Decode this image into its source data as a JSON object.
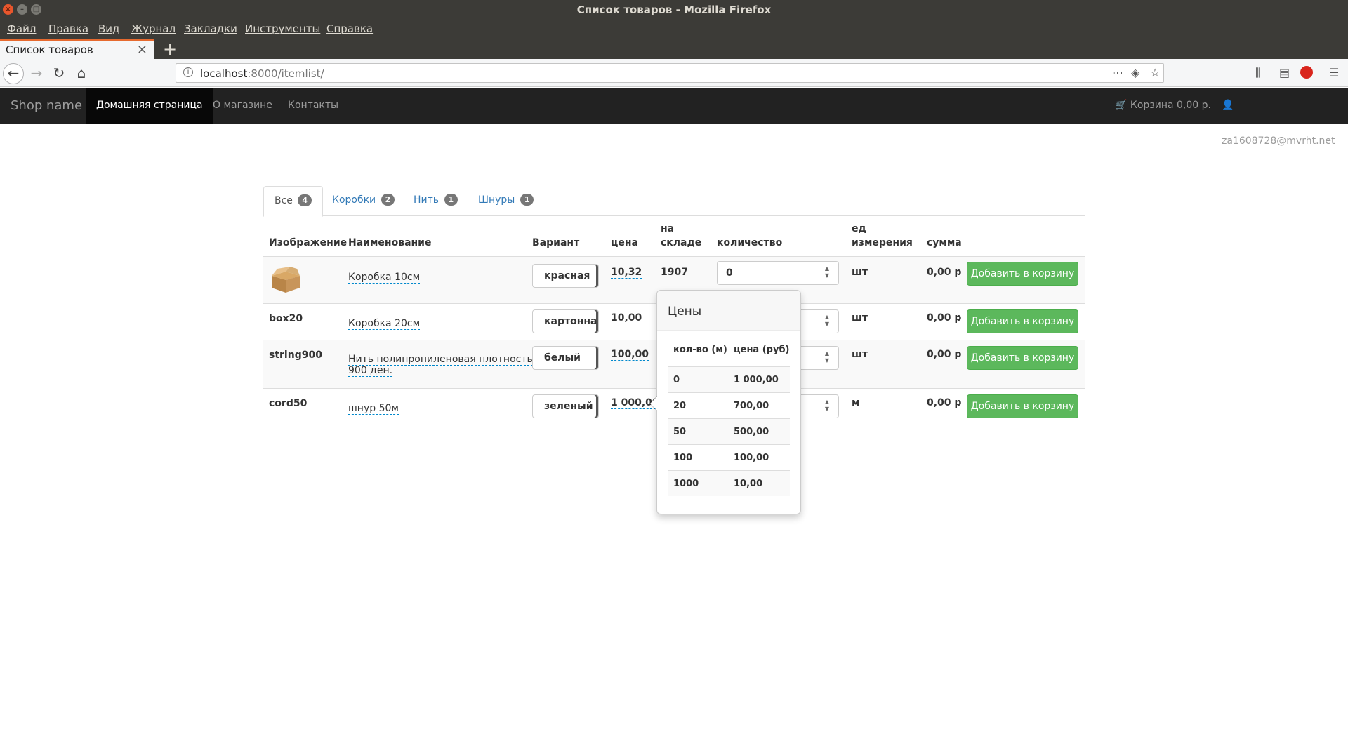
{
  "browser": {
    "window_title": "Список товаров - Mozilla Firefox",
    "menu": [
      "Файл",
      "Правка",
      "Вид",
      "Журнал",
      "Закладки",
      "Инструменты",
      "Справка"
    ],
    "tab_title": "Список товаров",
    "tab_close": "×",
    "new_tab": "+",
    "url_host": "localhost",
    "url_rest": ":8000/itemlist/"
  },
  "site": {
    "brand": "Shop name",
    "nav": [
      "Домашняя страница",
      "О магазине",
      "Контакты"
    ],
    "cart": "Корзина 0,00 р.",
    "user": "za1608728@mvrht.net"
  },
  "tabs": [
    {
      "label": "Все",
      "count": "4"
    },
    {
      "label": "Коробки",
      "count": "2"
    },
    {
      "label": "Нить",
      "count": "1"
    },
    {
      "label": "Шнуры",
      "count": "1"
    }
  ],
  "table": {
    "headers": {
      "image": "Изображение",
      "name": "Наименование",
      "variant": "Вариант",
      "price": "цена",
      "stock_1": "на",
      "stock_2": "складе",
      "qty": "количество",
      "unit_1": "ед",
      "unit_2": "измерения",
      "sum": "сумма"
    },
    "rows": [
      {
        "image": "",
        "name": "Коробка 10см",
        "variant": "красная",
        "price": "10,32",
        "stock": "1907",
        "qty": "0",
        "unit": "шт",
        "sum": "0,00 р",
        "button": "Добавить в корзину"
      },
      {
        "image": "box20",
        "name": "Коробка 20см",
        "variant": "картонна",
        "price": "10,00",
        "stock": "",
        "qty": "",
        "unit": "шт",
        "sum": "0,00 р",
        "button": "Добавить в корзину"
      },
      {
        "image": "string900",
        "name_1": "Нить полипропиленовая плотность",
        "name_2": "900 ден.",
        "variant": "белый",
        "price": "100,00",
        "stock": "",
        "qty": "",
        "unit": "шт",
        "sum": "0,00 р",
        "button": "Добавить в корзину"
      },
      {
        "image": "cord50",
        "name": "шнур 50м",
        "variant": "зеленый",
        "price": "1 000,00",
        "stock": "",
        "qty": "",
        "unit": "м",
        "sum": "0,00 р",
        "button": "Добавить в корзину"
      }
    ]
  },
  "popover": {
    "title": "Цены",
    "col_qty": "кол-во (м)",
    "col_price": "цена (руб)",
    "rows": [
      {
        "qty": "0",
        "price": "1 000,00"
      },
      {
        "qty": "20",
        "price": "700,00"
      },
      {
        "qty": "50",
        "price": "500,00"
      },
      {
        "qty": "100",
        "price": "100,00"
      },
      {
        "qty": "1000",
        "price": "10,00"
      }
    ]
  }
}
